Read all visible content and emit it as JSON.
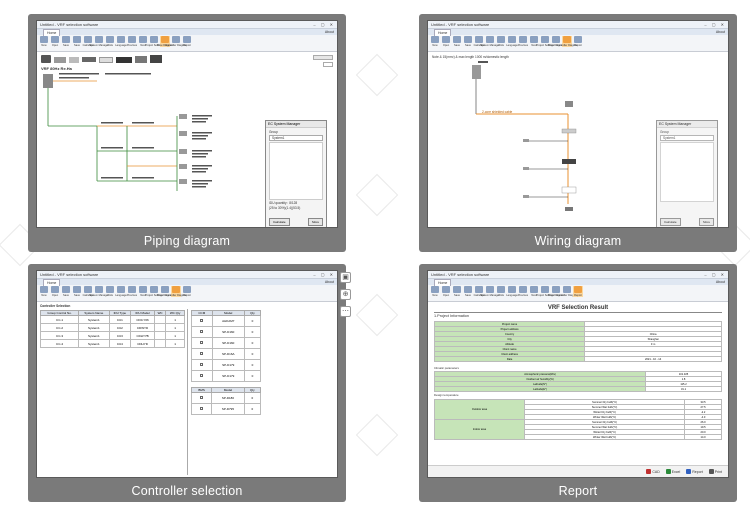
{
  "app": {
    "title": "Untitled - VRF selection software",
    "menu_tab": "Home",
    "about": "About"
  },
  "toolbar": [
    "New",
    "Open",
    "Save",
    "Save",
    "Calculate",
    "System Manager",
    "Units",
    "Language",
    "Previous",
    "Next",
    "Project Settings",
    "Flow Diagram",
    "Controller Diagram",
    "Report"
  ],
  "panels": {
    "piping": {
      "caption": "Piping diagram",
      "active_tool": "Flow Diagram",
      "system_title": "VRF 80Hz Re.Ha",
      "dialog": {
        "title": "EC System Manager",
        "group_label": "Group",
        "group_value": "System1",
        "qty_label": "IDU quantity : 8/128",
        "ratio": "(25 to 30%)(1.4)(53.5)",
        "calculate": "Calculate",
        "more": "More"
      }
    },
    "wiring": {
      "caption": "Wiring diagram",
      "active_tool": "Controller Diagram",
      "note": "Note & 15(mm²) & max length 1000 m/domestic length",
      "line_label": "2-core shielded cable",
      "dialog": {
        "title": "EC System Manager",
        "group_label": "Group",
        "group_value": "System1",
        "calculate": "Calculate",
        "more": "More"
      }
    },
    "controller": {
      "caption": "Controller selection",
      "active_tool": "Controller Diagram",
      "section": "Controller Selection",
      "columns": [
        "Group Control No.",
        "System Name",
        "IDU Type",
        "IDU Model",
        "WC",
        "WC Qty"
      ],
      "rows": [
        [
          "CC-1",
          "System1",
          "CU1",
          "CD0-Y06",
          "",
          "1"
        ],
        [
          "CC-2",
          "System1",
          "CU2",
          "CDWYD",
          "",
          "1"
        ],
        [
          "CC-3",
          "System1",
          "CU3",
          "CDHY7B",
          "",
          "1"
        ],
        [
          "CC-4",
          "System1",
          "CU4",
          "CDHYD",
          "",
          "1"
        ]
      ],
      "ccm_columns": [
        "CCM",
        "Model",
        "Qty"
      ],
      "ccm_rows": [
        [
          "",
          "AHKAM7",
          "0"
        ],
        [
          "",
          "SP-D160",
          "0"
        ],
        [
          "",
          "SP-D160",
          "0"
        ],
        [
          "",
          "SP-D16A",
          "0"
        ],
        [
          "",
          "SP-D179",
          "0"
        ],
        [
          "",
          "SP-D179",
          "0"
        ]
      ],
      "bms_columns": [
        "BMS",
        "Model",
        "Qty"
      ],
      "bms_rows": [
        [
          "",
          "SP-D180",
          "0"
        ],
        [
          "",
          "SP-D795",
          "0"
        ]
      ]
    },
    "report": {
      "caption": "Report",
      "active_tool": "Report",
      "heading": "VRF Selection Result",
      "section1": "1.Project Information",
      "info_rows": [
        [
          "Project name",
          ""
        ],
        [
          "Project address",
          ""
        ],
        [
          "Country",
          "China"
        ],
        [
          "City",
          "Shanghai"
        ],
        [
          "Altitude",
          "0 m"
        ],
        [
          "Client name",
          ""
        ],
        [
          "Client address",
          ""
        ],
        [
          "Date",
          "2021 - 10 - 14"
        ]
      ],
      "section2": "Climatic parameters",
      "climate_rows": [
        [
          "Atmospheric pressure(kPa)",
          "101.325"
        ],
        [
          "Outdoor air humidity(%)",
          "1.8"
        ],
        [
          "Latitude(N°)",
          "115.2"
        ],
        [
          "Latitude(E°)",
          "31.1"
        ]
      ],
      "section3": "Design temperature",
      "temp_groups": [
        "Outdoor area",
        "Indoor area"
      ],
      "temp_rows": [
        [
          "Summer Dry bulb(°C)",
          "33.5"
        ],
        [
          "Summer Wet bulb(°C)",
          "27.5"
        ],
        [
          "Winter Dry bulb(°C)",
          "-2.2"
        ],
        [
          "Winter Wet bulb(°C)",
          "-4.0"
        ],
        [
          "Summer Dry bulb(°C)",
          "26.0"
        ],
        [
          "Summer Wet bulb(°C)",
          "19.5"
        ],
        [
          "Winter Dry bulb(°C)",
          "20.0"
        ],
        [
          "Winter Wet bulb(°C)",
          "14.0"
        ]
      ],
      "export_buttons": [
        "CAD",
        "Excel",
        "Report",
        "Print"
      ]
    }
  },
  "colors": {
    "panel_bg": "#7a7a7a",
    "active_tool": "#f0a040",
    "report_green": "#c6e4b8",
    "pipe_orange": "#e89030",
    "pipe_green": "#3a8a3a"
  }
}
